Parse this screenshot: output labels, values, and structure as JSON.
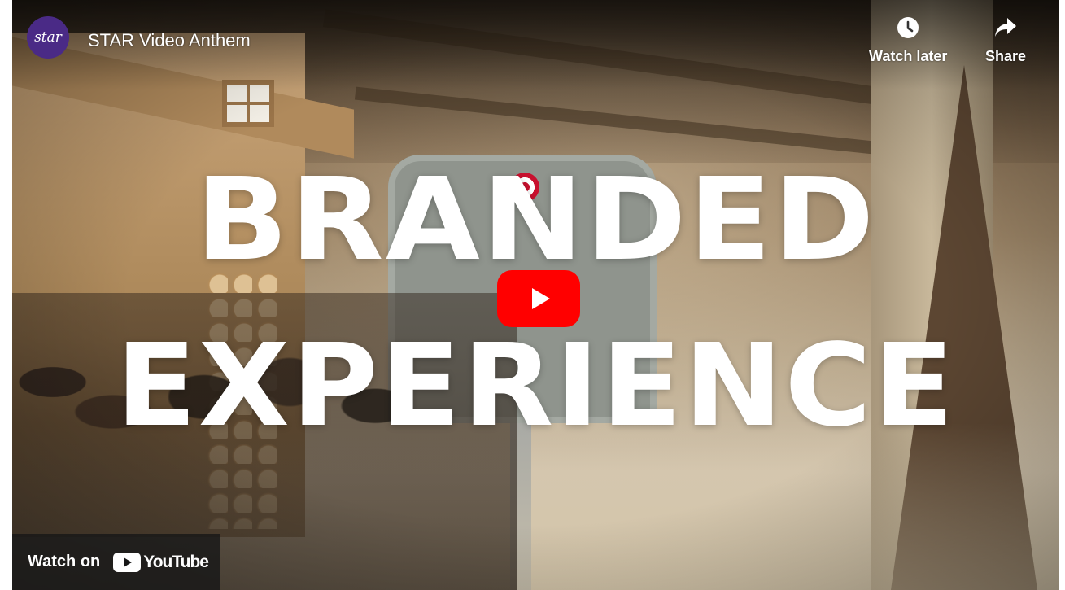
{
  "header": {
    "channel_avatar_text": "star",
    "title": "STAR Video Anthem",
    "watch_later_label": "Watch later",
    "share_label": "Share"
  },
  "thumbnail": {
    "line1": "BRANDED",
    "line2": "EXPERIENCE",
    "icons": [
      "clock-icon",
      "share-arrow-icon",
      "play-icon",
      "youtube-logo-icon"
    ]
  },
  "footer": {
    "watch_on_label": "Watch on",
    "youtube_wordmark": "YouTube"
  },
  "colors": {
    "play_button": "#ff0000",
    "avatar_bg": "#4a2a86",
    "overlay_bar": "#171717"
  }
}
